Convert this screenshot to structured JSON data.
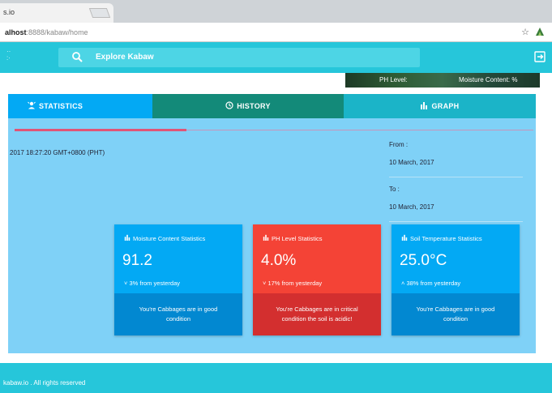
{
  "browser": {
    "tab_title": "s.io",
    "tab_close": "×",
    "url_host": "alhost",
    "url_path": ":8888/kabaw/home"
  },
  "nav": {
    "search_label": "Explore Kabaw"
  },
  "banner": {
    "ph_label": "PH Level:",
    "moisture_label": "Moisture Content: %"
  },
  "tabs": [
    {
      "label": "STATISTICS",
      "icon": "person-alert-icon"
    },
    {
      "label": "HISTORY",
      "icon": "history-icon"
    },
    {
      "label": "GRAPH",
      "icon": "bar-chart-icon"
    }
  ],
  "main": {
    "timestamp": "2017 18:27:20 GMT+0800 (PHT)",
    "from_label": "From :",
    "from_value": "10 March, 2017",
    "to_label": "To :",
    "to_value": "10 March, 2017"
  },
  "cards": [
    {
      "title": "Moisture Content Statistics",
      "value": "91.2",
      "change": "3% from yesterday",
      "status": "You're Cabbages are in good condition"
    },
    {
      "title": "PH Level Statistics",
      "value": "4.0%",
      "change": "17% from yesterday",
      "status": "You're Cabbages are in critical condition the soil is acidic!"
    },
    {
      "title": "Soil Temperature Statistics",
      "value": "25.0°C",
      "change": "38% from yesterday",
      "status": "You're Cabbages are in good condition"
    }
  ],
  "footer": {
    "text": "kabaw.io . All rights reserved"
  },
  "colors": {
    "primary": "#26c6da",
    "tab_active": "#03a9f4",
    "tab_history": "#138a79",
    "alert": "#f44336"
  }
}
